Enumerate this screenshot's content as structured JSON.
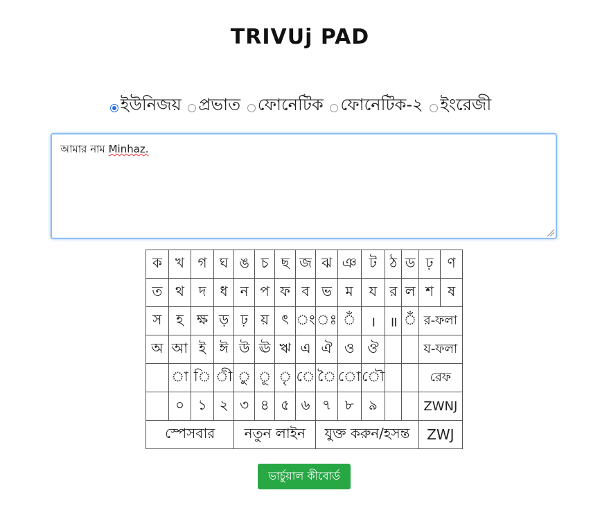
{
  "title": "TRIVUj PAD",
  "layouts": [
    {
      "label": "ইউনিজয়",
      "checked": true
    },
    {
      "label": "প্রভাত",
      "checked": false
    },
    {
      "label": "ফোনেটিক",
      "checked": false
    },
    {
      "label": "ফোনেটিক-২",
      "checked": false
    },
    {
      "label": "ইংরেজী",
      "checked": false
    }
  ],
  "editor": {
    "text_bn": "আমার নাম ",
    "text_misspelled": "Minhaz."
  },
  "keyboard": {
    "row1": [
      "ক",
      "খ",
      "গ",
      "ঘ",
      "ঙ",
      "চ",
      "ছ",
      "জ",
      "ঝ",
      "ঞ",
      "ট",
      "ঠ",
      "ড",
      "ঢ়",
      "ণ"
    ],
    "row2": [
      "ত",
      "থ",
      "দ",
      "ধ",
      "ন",
      "প",
      "ফ",
      "ব",
      "ভ",
      "ম",
      "য",
      "র",
      "ল",
      "শ",
      "ষ"
    ],
    "row3": [
      "স",
      "হ",
      "ক্ষ",
      "ড়",
      "ঢ়",
      "য়",
      "ৎ",
      "ং",
      "ঃ",
      "ঁ",
      "।",
      "॥",
      "ঁ",
      "র-ফলা"
    ],
    "row4": [
      "অ",
      "আ",
      "ই",
      "ঈ",
      "উ",
      "ঊ",
      "ঋ",
      "এ",
      "ঐ",
      "ও",
      "ঔ",
      "",
      "",
      "য-ফলা"
    ],
    "row5": [
      "",
      "া",
      "ি",
      "ী",
      "ু",
      "ূ",
      "ৃ",
      "ে",
      "ৈ",
      "ো",
      "ৌ",
      "",
      "",
      "রেফ"
    ],
    "row6": [
      "",
      "০",
      "১",
      "২",
      "৩",
      "৪",
      "৫",
      "৬",
      "৭",
      "৮",
      "৯",
      "",
      "",
      "ZWNJ"
    ],
    "row7": [
      "স্পেসবার",
      "নতুন লাইন",
      "যুক্ত করুন/হসন্ত",
      "ZWJ"
    ]
  },
  "virtual_keyboard_button": "ভার্চুয়াল কীবোর্ড",
  "colors": {
    "accent": "#28a745",
    "radio": "#2b6fd6",
    "focus_border": "#8dbdf3"
  }
}
